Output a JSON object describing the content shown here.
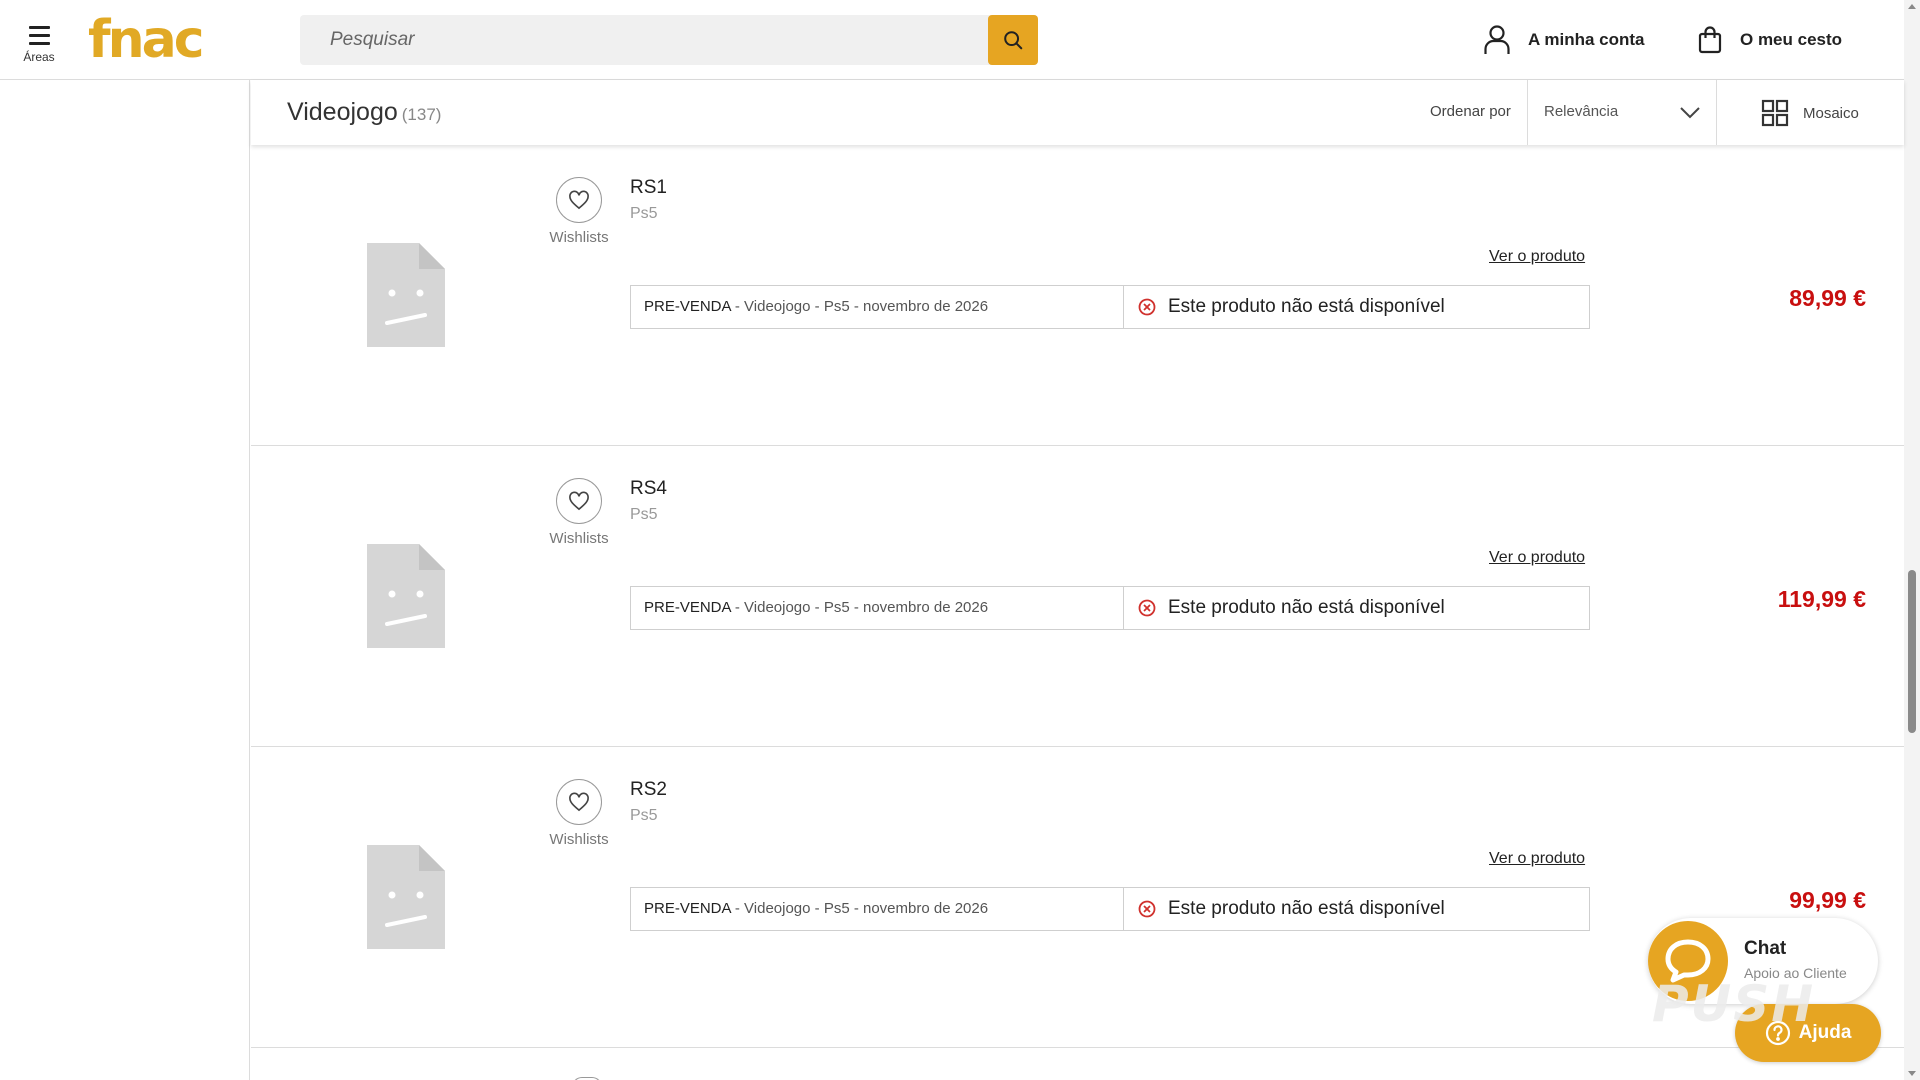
{
  "header": {
    "menu_label": "Áreas",
    "logo_text": "fnac",
    "search_placeholder": "Pesquisar",
    "account_label": "A minha conta",
    "cart_label": "O meu cesto"
  },
  "sortbar": {
    "title": "Videojogo",
    "count": "(137)",
    "order_label": "Ordenar por",
    "order_value": "Relevância",
    "view_label": "Mosaico"
  },
  "products": [
    {
      "name": "RS1",
      "platform": "Ps5",
      "wishlist_label": "Wishlists",
      "view_label": "Ver o produto",
      "offer_tag": "PRE-VENDA",
      "offer_details": " - Videojogo - Ps5 - novembro de 2026",
      "availability": "Este produto não está disponível",
      "price": "89,99 €"
    },
    {
      "name": "RS4",
      "platform": "Ps5",
      "wishlist_label": "Wishlists",
      "view_label": "Ver o produto",
      "offer_tag": "PRE-VENDA",
      "offer_details": " - Videojogo - Ps5 - novembro de 2026",
      "availability": "Este produto não está disponível",
      "price": "119,99 €"
    },
    {
      "name": "RS2",
      "platform": "Ps5",
      "wishlist_label": "Wishlists",
      "view_label": "Ver o produto",
      "offer_tag": "PRE-VENDA",
      "offer_details": " - Videojogo - Ps5 - novembro de 2026",
      "availability": "Este produto não está disponível",
      "price": "99,99 €"
    }
  ],
  "chat": {
    "title": "Chat",
    "subtitle": "Apoio ao Cliente"
  },
  "help": {
    "label": "Ajuda"
  },
  "watermark": "PUSH",
  "colors": {
    "brand": "#e1a925",
    "accent": "#e6a522",
    "price": "#c80f0f",
    "unavailable": "#d0312d"
  },
  "icons": {
    "menu": "hamburger-icon",
    "search": "search-icon",
    "account": "user-icon",
    "cart": "shopping-bag-icon",
    "sort": "chevron-down-icon",
    "view": "grid-icon",
    "wishlist": "heart-icon",
    "unavailable": "x-circle-icon",
    "placeholder": "no-image-icon",
    "chat": "chat-bubble-icon",
    "help": "question-icon"
  }
}
